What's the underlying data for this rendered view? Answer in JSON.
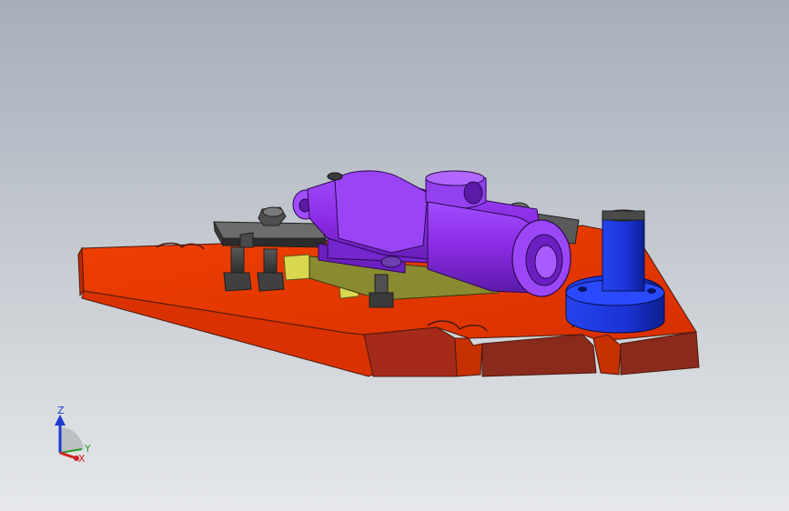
{
  "viewport": {
    "axes": {
      "z_label": "Z",
      "y_label": "Y",
      "x_label": "X"
    }
  },
  "colors": {
    "background_top": "#a6aebb",
    "background_bottom": "#e6e8ea",
    "base_plate": "#e83300",
    "base_plate_side": "#8a2a1c",
    "workpiece": "#8a2be2",
    "clamp": "#3b3b3b",
    "support_block": "#d8d850",
    "locator_pin": "#1b33d6",
    "axis_z": "#1a3ad0",
    "axis_y": "#2a9a2a",
    "axis_x": "#d02020"
  }
}
